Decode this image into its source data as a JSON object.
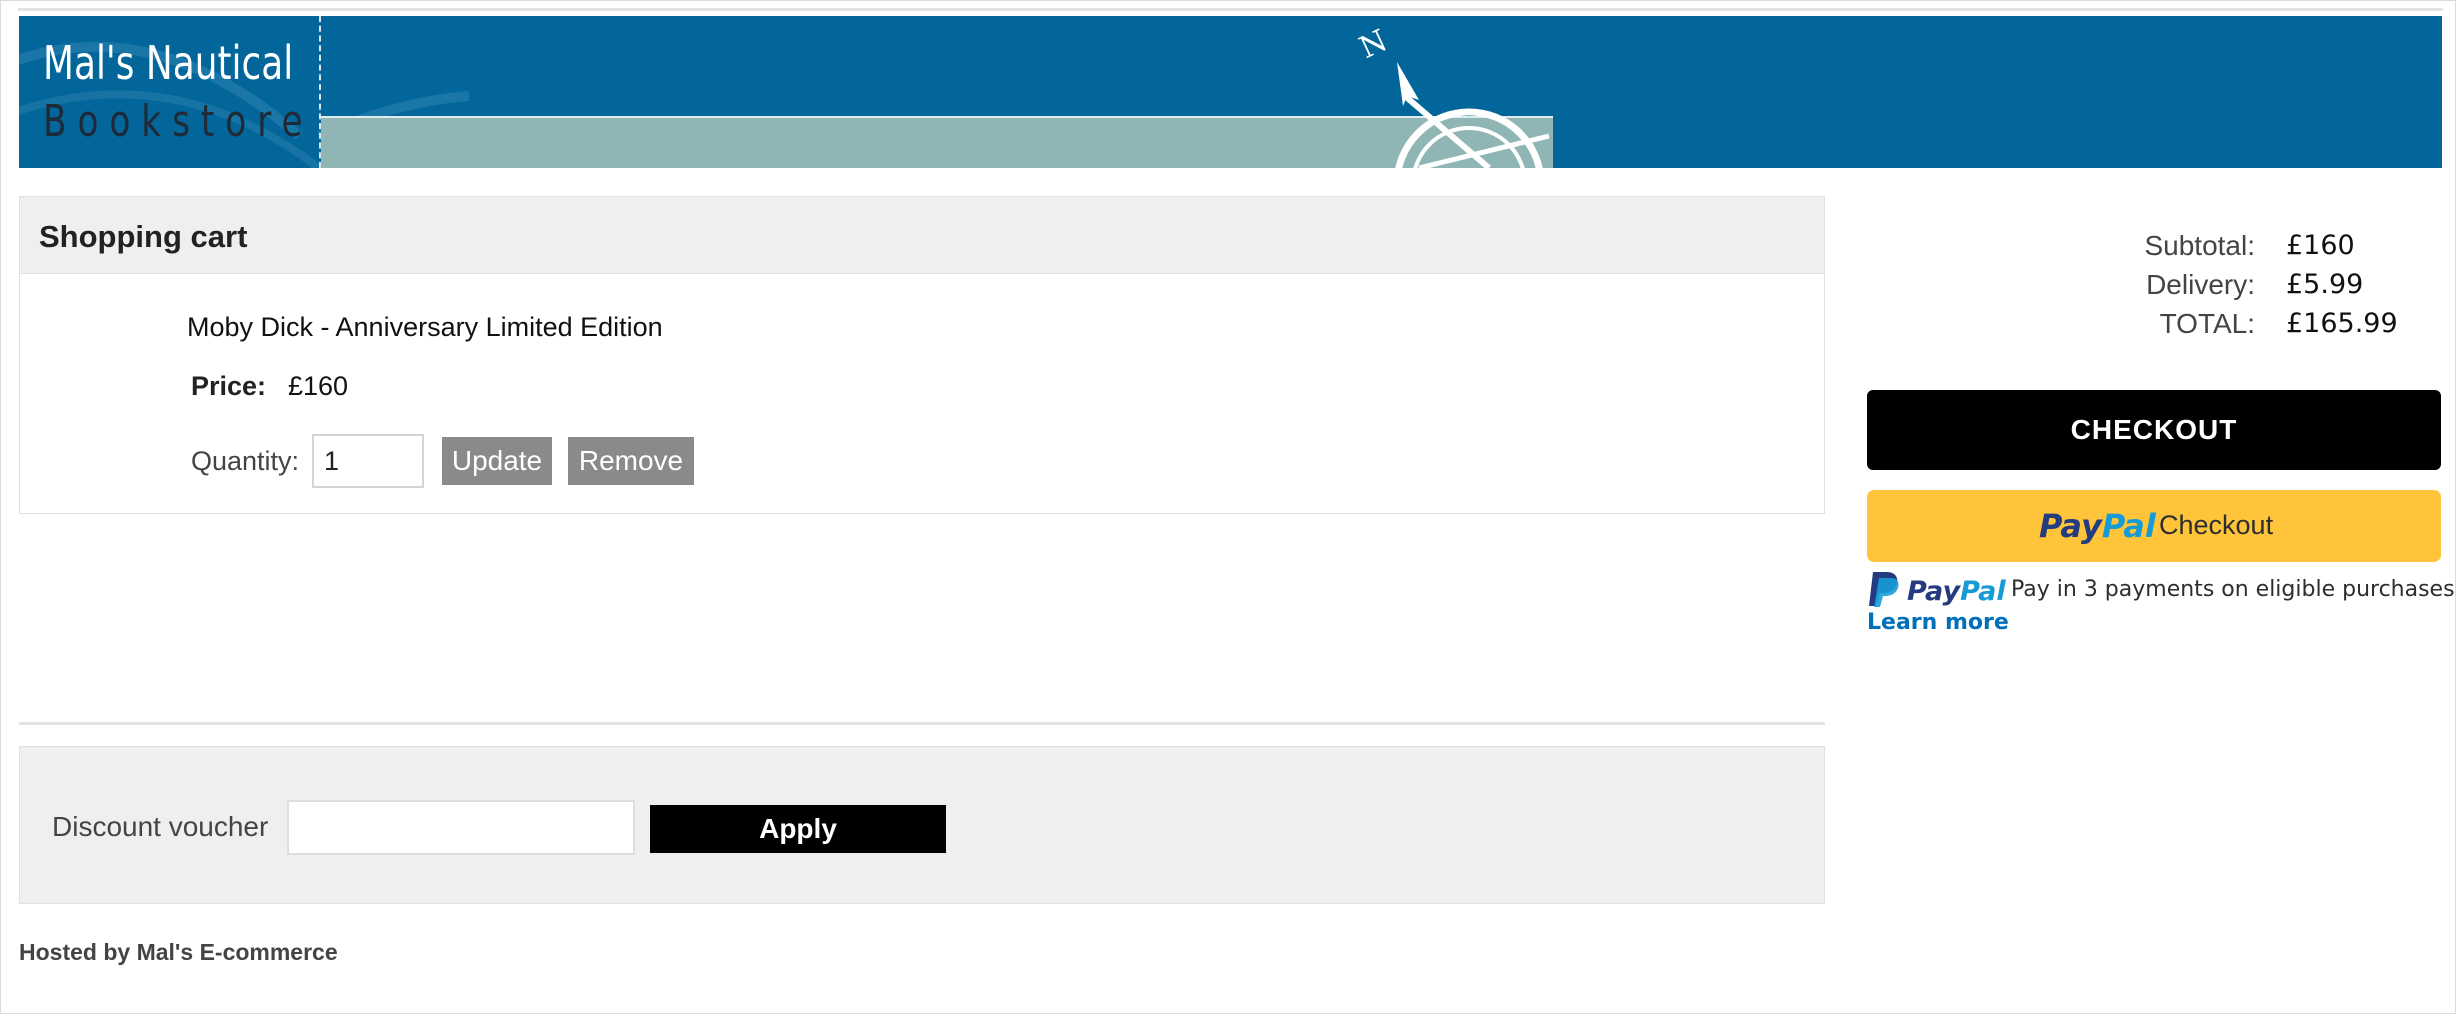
{
  "header": {
    "logo_line1": "Mal's Nautical",
    "logo_line2": "Bookstore",
    "compass_letter": "N",
    "colors": {
      "banner": "#02669b",
      "strip": "#8fb5b5"
    }
  },
  "cart": {
    "title": "Shopping cart",
    "item": {
      "name": "Moby Dick - Anniversary Limited Edition",
      "price_label": "Price:",
      "price": "£160",
      "quantity_label": "Quantity:",
      "quantity": "1",
      "update_label": "Update",
      "remove_label": "Remove"
    }
  },
  "voucher": {
    "label": "Discount voucher",
    "value": "",
    "apply_label": "Apply"
  },
  "footer": {
    "text": "Hosted by Mal's E-commerce"
  },
  "summary": {
    "subtotal_label": "Subtotal:",
    "subtotal": "£160",
    "delivery_label": "Delivery:",
    "delivery": "£5.99",
    "total_label": "TOTAL:",
    "total": "£165.99",
    "checkout_label": "CHECKOUT",
    "paypal": {
      "brand_pay": "Pay",
      "brand_pal": "Pal",
      "checkout_text": "Checkout",
      "paylater_text": "Pay in 3 payments on eligible purchases.",
      "learn_more": "Learn more",
      "colors": {
        "button": "#ffc439",
        "dark_blue": "#253b80",
        "light_blue": "#179bd7"
      }
    }
  },
  "icons": [
    "compass-rose-icon",
    "paypal-p-icon"
  ]
}
